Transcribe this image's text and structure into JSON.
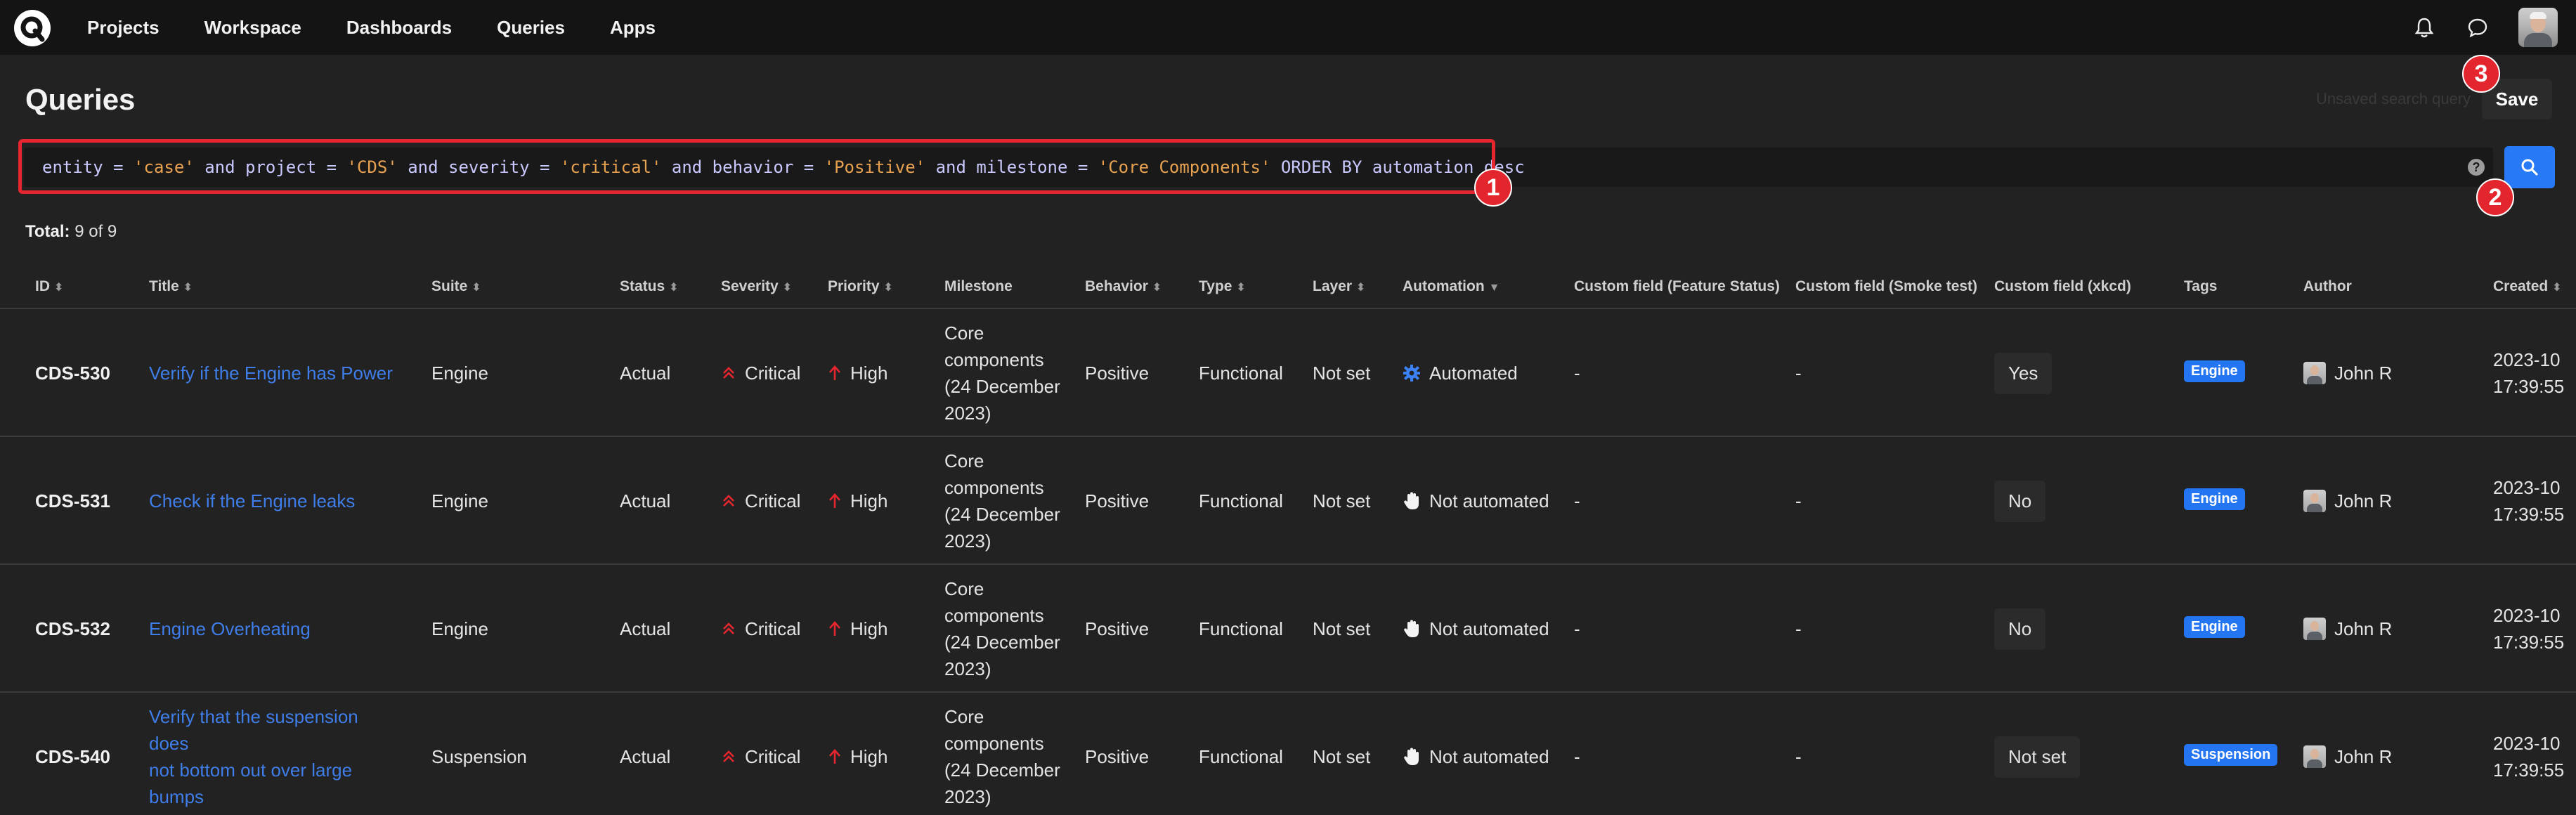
{
  "nav": {
    "items": [
      "Projects",
      "Workspace",
      "Dashboards",
      "Queries",
      "Apps"
    ]
  },
  "page": {
    "title": "Queries",
    "unsaved_text": "Unsaved search query",
    "save_label": "Save"
  },
  "query": {
    "parts": [
      {
        "t": "entity = ",
        "k": "kw"
      },
      {
        "t": "'case'",
        "k": "str"
      },
      {
        "t": " and project = ",
        "k": "kw"
      },
      {
        "t": "'CDS'",
        "k": "str"
      },
      {
        "t": " and severity = ",
        "k": "kw"
      },
      {
        "t": "'critical'",
        "k": "str"
      },
      {
        "t": " and behavior = ",
        "k": "kw"
      },
      {
        "t": "'Positive'",
        "k": "str"
      },
      {
        "t": " and milestone = ",
        "k": "kw"
      },
      {
        "t": "'Core Components'",
        "k": "str"
      },
      {
        "t": " ORDER BY automation desc",
        "k": "kw"
      }
    ],
    "help_label": "?"
  },
  "markers": [
    "1",
    "2",
    "3"
  ],
  "total": {
    "label": "Total:",
    "value": "9 of 9"
  },
  "columns": [
    "ID",
    "Title",
    "Suite",
    "Status",
    "Severity",
    "Priority",
    "Milestone",
    "Behavior",
    "Type",
    "Layer",
    "Automation",
    "Custom field (Feature Status)",
    "Custom field (Smoke test)",
    "Custom field (xkcd)",
    "Tags",
    "Author",
    "Created"
  ],
  "sortable": [
    true,
    true,
    true,
    true,
    true,
    true,
    false,
    true,
    true,
    true,
    true,
    false,
    false,
    false,
    false,
    false,
    true
  ],
  "rows": [
    {
      "id": "CDS-530",
      "title": [
        "Verify if the Engine has Power"
      ],
      "suite": "Engine",
      "status": "Actual",
      "severity": "Critical",
      "priority": "High",
      "milestone": [
        "Core",
        "components",
        "(24 December",
        "2023)"
      ],
      "behavior": "Positive",
      "type": "Functional",
      "layer": "Not set",
      "automation": "Automated",
      "automation_icon": "gear-icon",
      "feature_status": "-",
      "smoke_test": "-",
      "xkcd": "Yes",
      "tag": "Engine",
      "author": "John R",
      "created": [
        "2023-10",
        "17:39:55"
      ]
    },
    {
      "id": "CDS-531",
      "title": [
        "Check if the Engine leaks"
      ],
      "suite": "Engine",
      "status": "Actual",
      "severity": "Critical",
      "priority": "High",
      "milestone": [
        "Core",
        "components",
        "(24 December",
        "2023)"
      ],
      "behavior": "Positive",
      "type": "Functional",
      "layer": "Not set",
      "automation": "Not automated",
      "automation_icon": "hand-icon",
      "feature_status": "-",
      "smoke_test": "-",
      "xkcd": "No",
      "tag": "Engine",
      "author": "John R",
      "created": [
        "2023-10",
        "17:39:55"
      ]
    },
    {
      "id": "CDS-532",
      "title": [
        "Engine Overheating"
      ],
      "suite": "Engine",
      "status": "Actual",
      "severity": "Critical",
      "priority": "High",
      "milestone": [
        "Core",
        "components",
        "(24 December",
        "2023)"
      ],
      "behavior": "Positive",
      "type": "Functional",
      "layer": "Not set",
      "automation": "Not automated",
      "automation_icon": "hand-icon",
      "feature_status": "-",
      "smoke_test": "-",
      "xkcd": "No",
      "tag": "Engine",
      "author": "John R",
      "created": [
        "2023-10",
        "17:39:55"
      ]
    },
    {
      "id": "CDS-540",
      "title": [
        "Verify that the suspension does",
        "not bottom out over large",
        "bumps"
      ],
      "suite": "Suspension",
      "status": "Actual",
      "severity": "Critical",
      "priority": "High",
      "milestone": [
        "Core",
        "components",
        "(24 December",
        "2023)"
      ],
      "behavior": "Positive",
      "type": "Functional",
      "layer": "Not set",
      "automation": "Not automated",
      "automation_icon": "hand-icon",
      "feature_status": "-",
      "smoke_test": "-",
      "xkcd": "Not set",
      "tag": "Suspension",
      "author": "John R",
      "created": [
        "2023-10",
        "17:39:55"
      ]
    }
  ],
  "colors": {
    "accent": "#2779f5",
    "link": "#3f7de8",
    "critical": "#e5262f",
    "marker": "#e3262e",
    "query_string": "#e8a24f"
  }
}
